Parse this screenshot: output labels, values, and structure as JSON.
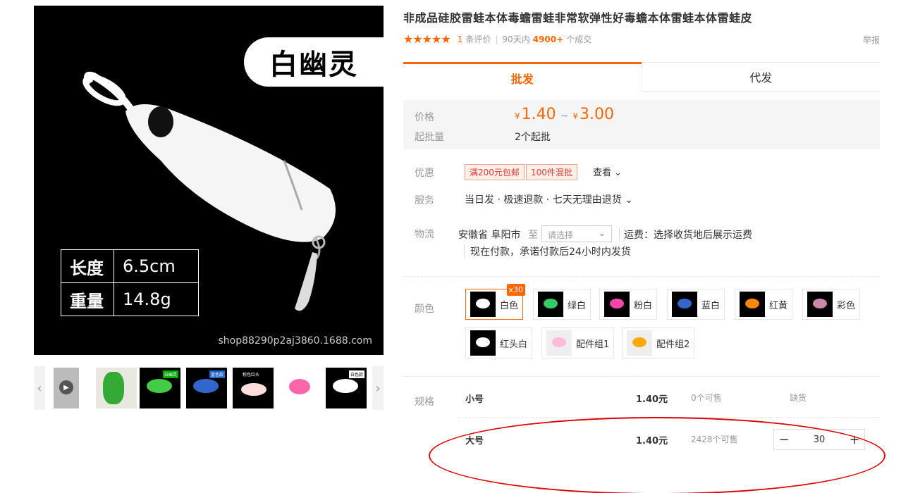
{
  "product": {
    "title": "非成品硅胶雷蛙本体毒蟾雷蛙非常软弹性好毒蟾本体雷蛙本体雷蛙皮",
    "stars": "★★★★★",
    "review_count": "1",
    "review_label": "条评价",
    "period_label": "90天内",
    "deal_count": "4900+",
    "deal_label": "个成交",
    "report_label": "举报"
  },
  "main_image": {
    "badge": "白幽灵",
    "specs": [
      {
        "key": "长度",
        "value": "6.5cm"
      },
      {
        "key": "重量",
        "value": "14.8g"
      }
    ],
    "shop_mark": "shop88290p2aj3860.1688.com"
  },
  "thumbnails": {
    "prev_icon": "‹",
    "next_icon": "›",
    "tags": [
      "白幽灵",
      "蓝色款",
      "粉色红头",
      "白色款"
    ]
  },
  "tabs": {
    "wholesale": "批发",
    "dropship": "代发"
  },
  "price": {
    "label": "价格",
    "currency": "¥",
    "min": "1.40",
    "tilde": "~",
    "max": "3.00",
    "moq_label": "起批量",
    "moq_value": "2个起批"
  },
  "promo": {
    "label": "优惠",
    "tags": [
      "满200元包邮",
      "100件混批"
    ],
    "view": "查看 ⌄"
  },
  "service": {
    "label": "服务",
    "value": "当日发 · 极速退款 · 七天无理由退货 ⌄"
  },
  "logistics": {
    "label": "物流",
    "from": "安徽省 阜阳市",
    "to_label": "至",
    "select_placeholder": "请选择",
    "freight": "运费：选择收货地后展示运费",
    "promise": "现在付款，承诺付款后24小时内发货"
  },
  "colors": {
    "label": "颜色",
    "badge": "x30",
    "items": [
      "白色",
      "绿白",
      "粉白",
      "蓝白",
      "红黄",
      "彩色",
      "红头白",
      "配件组1",
      "配件组2"
    ],
    "tint": [
      "#ffffff",
      "#3c6",
      "#f4a",
      "#36c",
      "#f80",
      "#c8a",
      "#fff",
      "#fbd",
      "#fa0"
    ]
  },
  "sku": {
    "label": "规格",
    "rows": [
      {
        "name": "小号",
        "price": "1.40元",
        "stock": "0个可售",
        "status": "缺货"
      },
      {
        "name": "大号",
        "price": "1.40元",
        "stock": "2428个可售",
        "qty": "30"
      }
    ],
    "minus": "−",
    "plus": "+"
  }
}
